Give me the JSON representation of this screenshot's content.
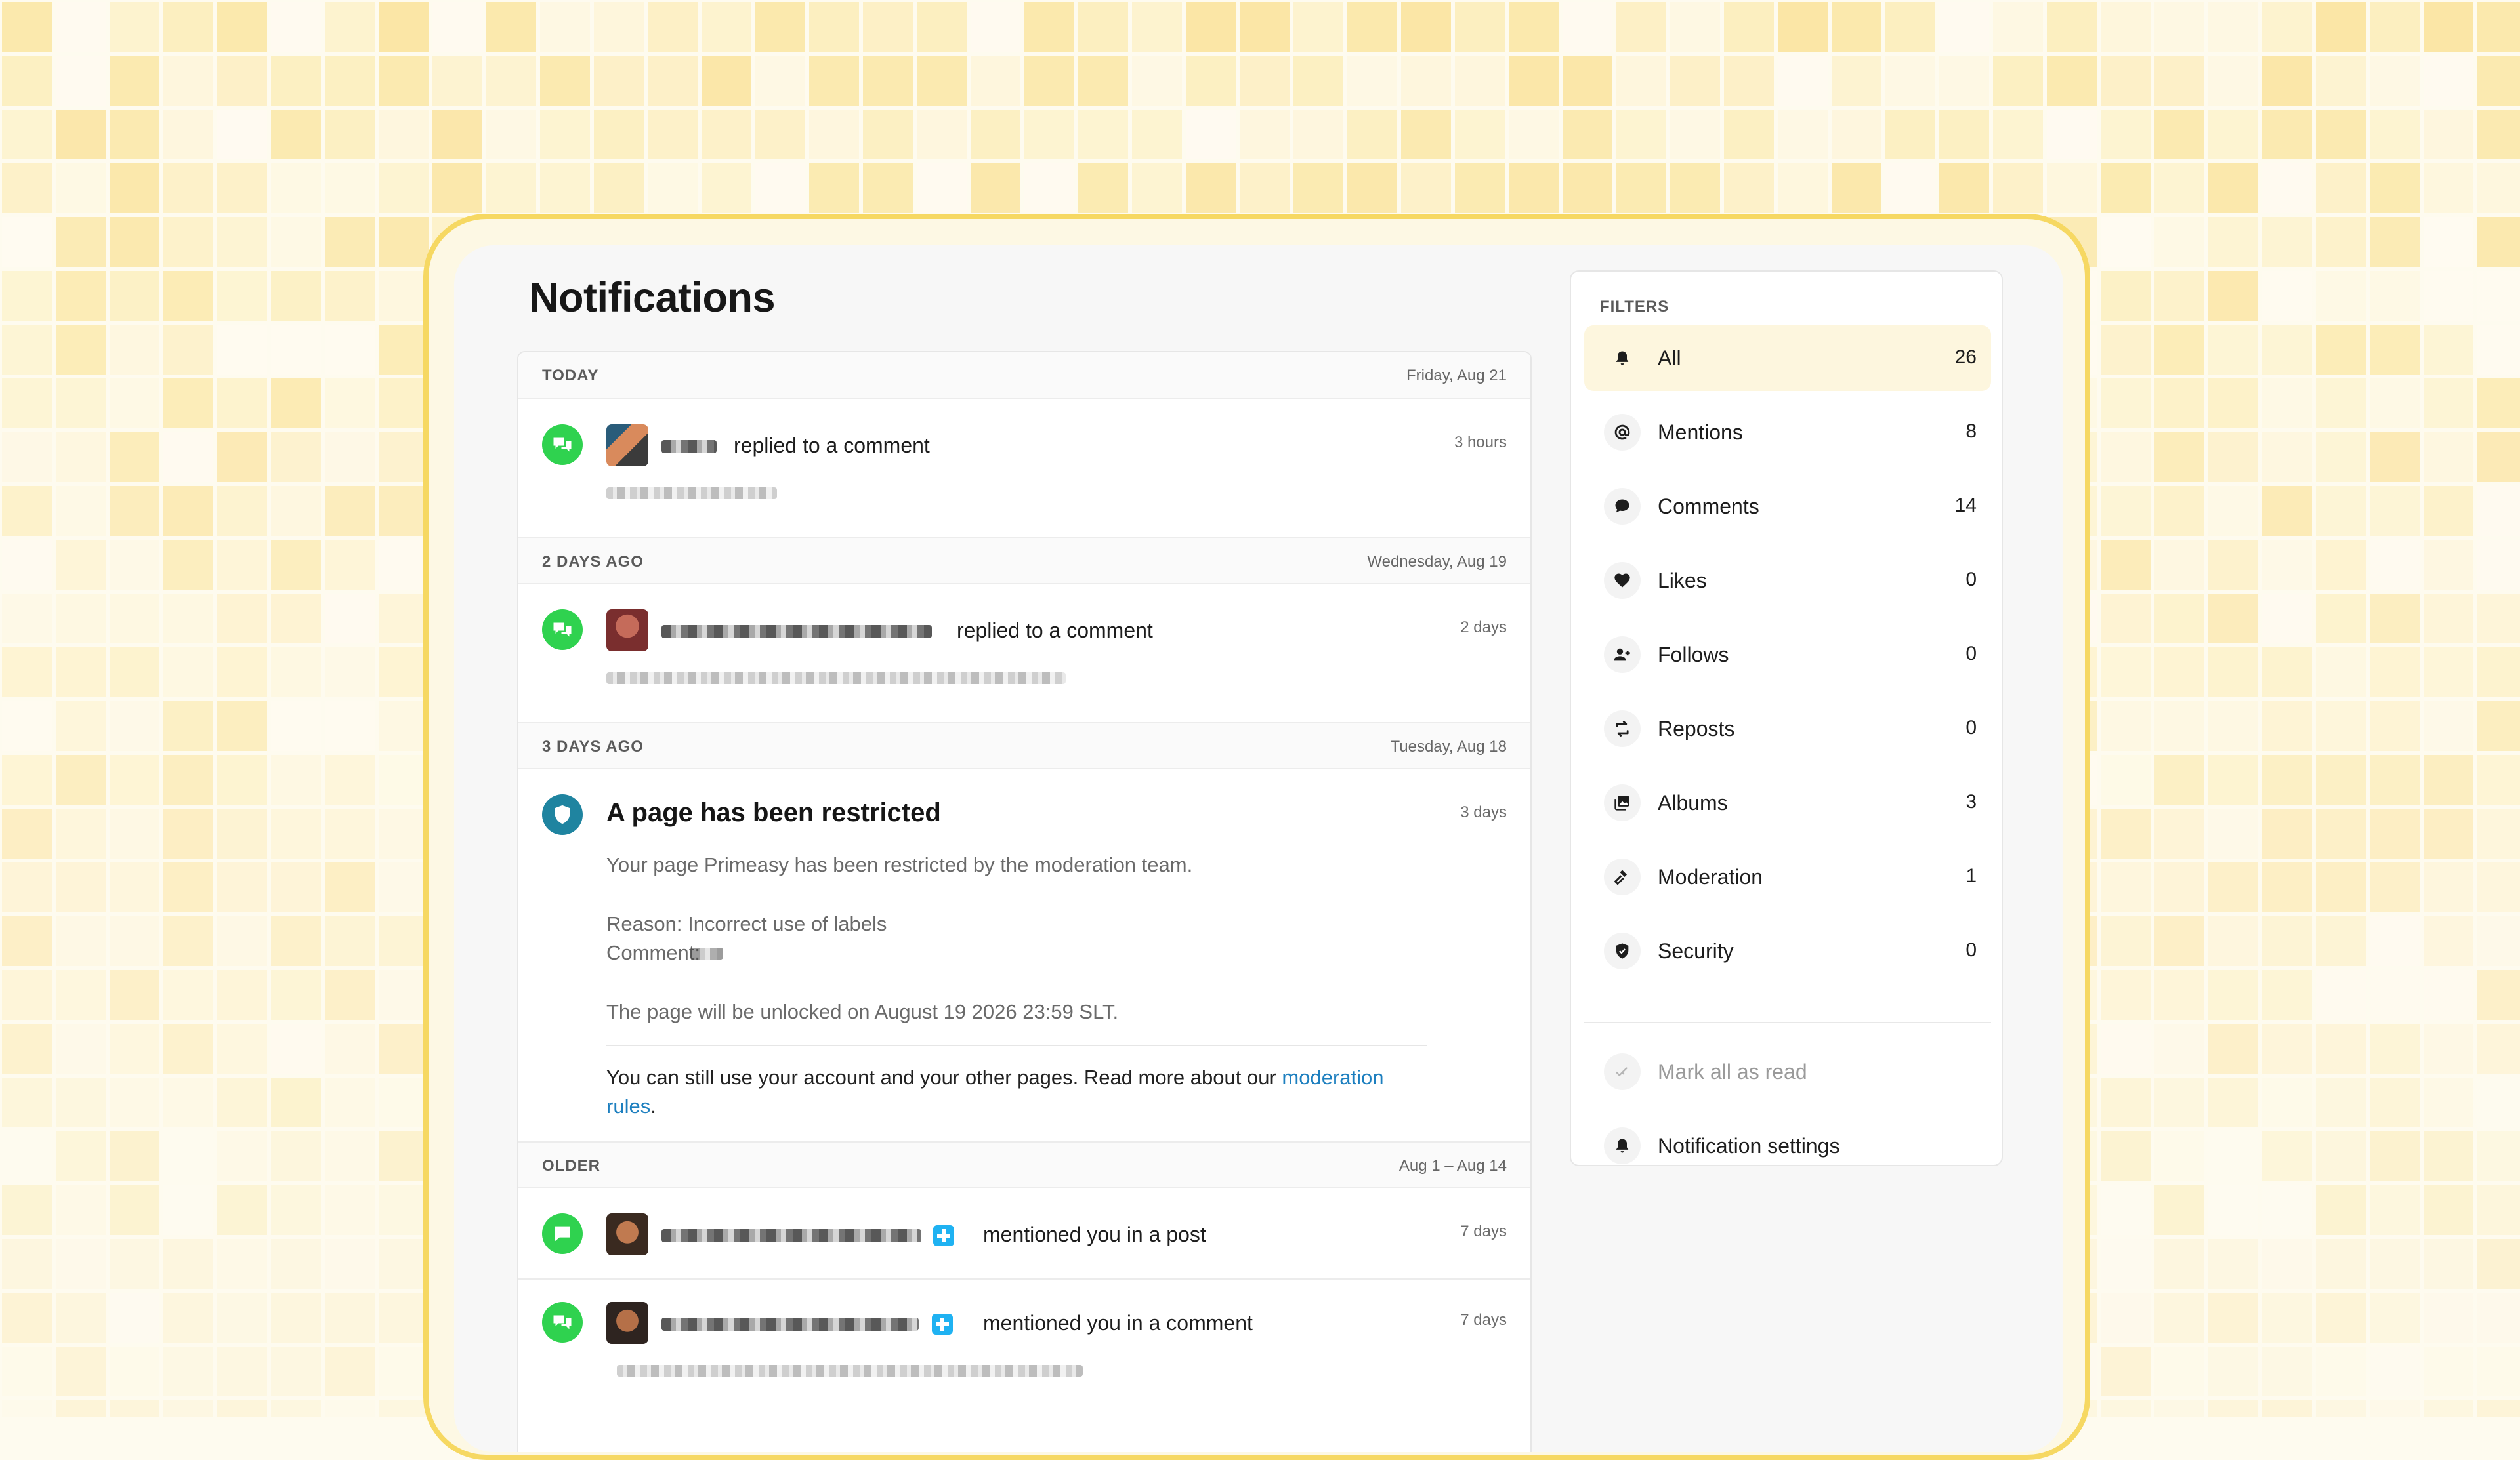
{
  "page": {
    "title": "Notifications"
  },
  "feed": {
    "today": {
      "label": "TODAY",
      "date": "Friday, Aug 21"
    },
    "item1": {
      "action": "replied to a comment",
      "time": "3 hours"
    },
    "two_days": {
      "label": "2 DAYS AGO",
      "date": "Wednesday, Aug 19"
    },
    "item2": {
      "action": "replied to a comment",
      "time": "2 days"
    },
    "three_days": {
      "label": "3 DAYS AGO",
      "date": "Tuesday, Aug 18"
    },
    "item3": {
      "title": "A page has been restricted",
      "time": "3 days",
      "line1": "Your page Primeasy has been restricted by the moderation team.",
      "reason": "Reason: Incorrect use of labels",
      "comment": "Comment:",
      "unlock": "The page will be unlocked on August 19 2026 23:59 SLT.",
      "note_prefix": "You can still use your account and your other pages. Read more about our",
      "link_part1": "moderation",
      "link_part2": "rules",
      "note_suffix": "."
    },
    "older": {
      "label": "OLDER",
      "date": "Aug 1 – Aug 14"
    },
    "item4": {
      "action": "mentioned you in a post",
      "time": "7 days"
    },
    "item5": {
      "action": "mentioned you in a comment",
      "time": "7 days"
    }
  },
  "filters": {
    "label": "FILTERS",
    "items": [
      {
        "label": "All",
        "count": "26",
        "icon": "bell-icon"
      },
      {
        "label": "Mentions",
        "count": "8",
        "icon": "at-icon"
      },
      {
        "label": "Comments",
        "count": "14",
        "icon": "speech-bubble-icon"
      },
      {
        "label": "Likes",
        "count": "0",
        "icon": "heart-icon"
      },
      {
        "label": "Follows",
        "count": "0",
        "icon": "user-plus-icon"
      },
      {
        "label": "Reposts",
        "count": "0",
        "icon": "repost-icon"
      },
      {
        "label": "Albums",
        "count": "3",
        "icon": "album-icon"
      },
      {
        "label": "Moderation",
        "count": "1",
        "icon": "gavel-icon"
      },
      {
        "label": "Security",
        "count": "0",
        "icon": "shield-icon"
      }
    ],
    "mark_all": "Mark all as read",
    "settings": "Notification settings"
  },
  "colors": {
    "accent_yellow": "#f6d862",
    "active_bg": "#fdf6de",
    "green": "#2fd24f",
    "teal": "#1f84a0",
    "link": "#1d7fbf"
  }
}
